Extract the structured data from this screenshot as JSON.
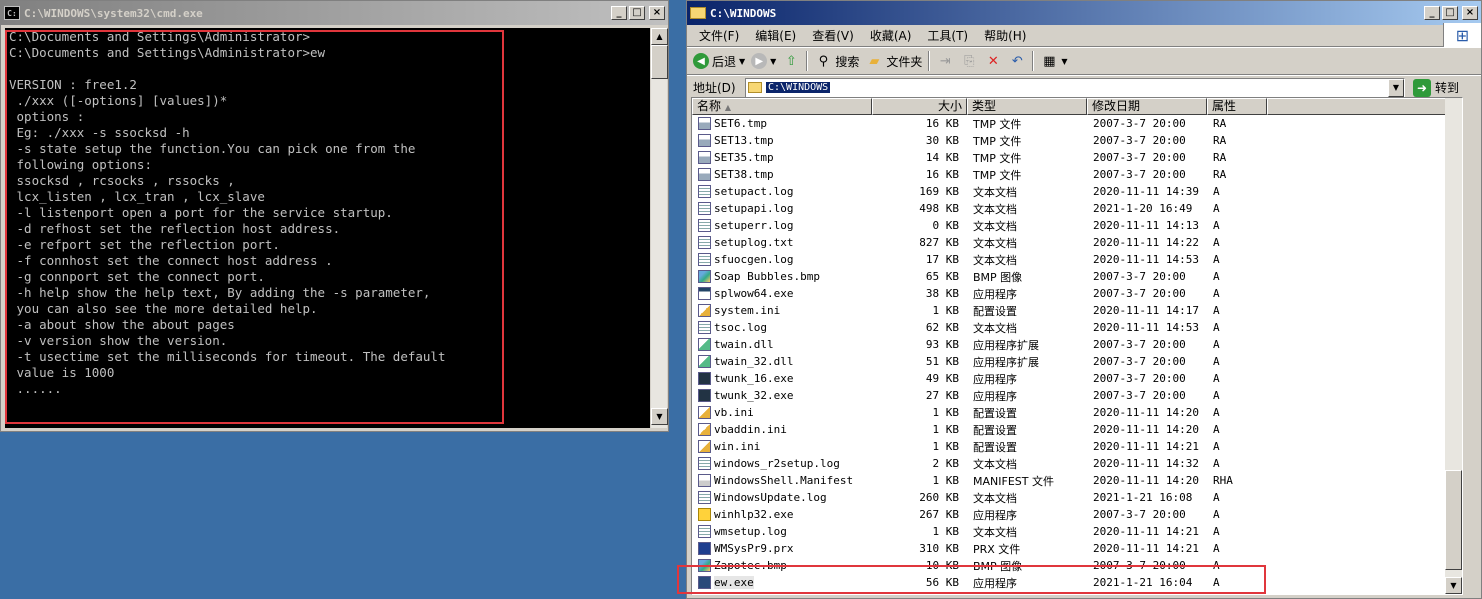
{
  "cmd": {
    "title": "C:\\WINDOWS\\system32\\cmd.exe",
    "lines": [
      "C:\\Documents and Settings\\Administrator>",
      "C:\\Documents and Settings\\Administrator>ew",
      "",
      "VERSION : free1.2",
      " ./xxx ([-options] [values])*",
      " options :",
      " Eg: ./xxx -s ssocksd -h",
      " -s state setup the function.You can pick one from the",
      " following options:",
      " ssocksd , rcsocks , rssocks ,",
      " lcx_listen , lcx_tran , lcx_slave",
      " -l listenport open a port for the service startup.",
      " -d refhost set the reflection host address.",
      " -e refport set the reflection port.",
      " -f connhost set the connect host address .",
      " -g connport set the connect port.",
      " -h help show the help text, By adding the -s parameter,",
      " you can also see the more detailed help.",
      " -a about show the about pages",
      " -v version show the version.",
      " -t usectime set the milliseconds for timeout. The default",
      " value is 1000",
      " ......"
    ]
  },
  "explorer": {
    "title": "C:\\WINDOWS",
    "menu": [
      "文件(F)",
      "编辑(E)",
      "查看(V)",
      "收藏(A)",
      "工具(T)",
      "帮助(H)"
    ],
    "toolbar": {
      "back": "后退",
      "search": "搜索",
      "folders": "文件夹"
    },
    "address_label": "地址(D)",
    "address_value": "C:\\WINDOWS",
    "go_label": "转到",
    "columns": [
      "名称",
      "大小",
      "类型",
      "修改日期",
      "属性"
    ],
    "files": [
      {
        "name": "SET6.tmp",
        "size": "16 KB",
        "type": "TMP 文件",
        "date": "2007-3-7 20:00",
        "attr": "RA",
        "icon": "tmp"
      },
      {
        "name": "SET13.tmp",
        "size": "30 KB",
        "type": "TMP 文件",
        "date": "2007-3-7 20:00",
        "attr": "RA",
        "icon": "tmp"
      },
      {
        "name": "SET35.tmp",
        "size": "14 KB",
        "type": "TMP 文件",
        "date": "2007-3-7 20:00",
        "attr": "RA",
        "icon": "tmp"
      },
      {
        "name": "SET38.tmp",
        "size": "16 KB",
        "type": "TMP 文件",
        "date": "2007-3-7 20:00",
        "attr": "RA",
        "icon": "tmp"
      },
      {
        "name": "setupact.log",
        "size": "169 KB",
        "type": "文本文档",
        "date": "2020-11-11 14:39",
        "attr": "A",
        "icon": "txt"
      },
      {
        "name": "setupapi.log",
        "size": "498 KB",
        "type": "文本文档",
        "date": "2021-1-20 16:49",
        "attr": "A",
        "icon": "txt"
      },
      {
        "name": "setuperr.log",
        "size": "0 KB",
        "type": "文本文档",
        "date": "2020-11-11 14:13",
        "attr": "A",
        "icon": "txt"
      },
      {
        "name": "setuplog.txt",
        "size": "827 KB",
        "type": "文本文档",
        "date": "2020-11-11 14:22",
        "attr": "A",
        "icon": "txt"
      },
      {
        "name": "sfuocgen.log",
        "size": "17 KB",
        "type": "文本文档",
        "date": "2020-11-11 14:53",
        "attr": "A",
        "icon": "txt"
      },
      {
        "name": "Soap Bubbles.bmp",
        "size": "65 KB",
        "type": "BMP 图像",
        "date": "2007-3-7 20:00",
        "attr": "A",
        "icon": "bmp"
      },
      {
        "name": "splwow64.exe",
        "size": "38 KB",
        "type": "应用程序",
        "date": "2007-3-7 20:00",
        "attr": "A",
        "icon": "exe"
      },
      {
        "name": "system.ini",
        "size": "1 KB",
        "type": "配置设置",
        "date": "2020-11-11 14:17",
        "attr": "A",
        "icon": "ini"
      },
      {
        "name": "tsoc.log",
        "size": "62 KB",
        "type": "文本文档",
        "date": "2020-11-11 14:53",
        "attr": "A",
        "icon": "txt"
      },
      {
        "name": "twain.dll",
        "size": "93 KB",
        "type": "应用程序扩展",
        "date": "2007-3-7 20:00",
        "attr": "A",
        "icon": "dll"
      },
      {
        "name": "twain_32.dll",
        "size": "51 KB",
        "type": "应用程序扩展",
        "date": "2007-3-7 20:00",
        "attr": "A",
        "icon": "dll"
      },
      {
        "name": "twunk_16.exe",
        "size": "49 KB",
        "type": "应用程序",
        "date": "2007-3-7 20:00",
        "attr": "A",
        "icon": "twunk"
      },
      {
        "name": "twunk_32.exe",
        "size": "27 KB",
        "type": "应用程序",
        "date": "2007-3-7 20:00",
        "attr": "A",
        "icon": "twunk"
      },
      {
        "name": "vb.ini",
        "size": "1 KB",
        "type": "配置设置",
        "date": "2020-11-11 14:20",
        "attr": "A",
        "icon": "ini"
      },
      {
        "name": "vbaddin.ini",
        "size": "1 KB",
        "type": "配置设置",
        "date": "2020-11-11 14:20",
        "attr": "A",
        "icon": "ini"
      },
      {
        "name": "win.ini",
        "size": "1 KB",
        "type": "配置设置",
        "date": "2020-11-11 14:21",
        "attr": "A",
        "icon": "ini"
      },
      {
        "name": "windows_r2setup.log",
        "size": "2 KB",
        "type": "文本文档",
        "date": "2020-11-11 14:32",
        "attr": "A",
        "icon": "txt"
      },
      {
        "name": "WindowsShell.Manifest",
        "size": "1 KB",
        "type": "MANIFEST 文件",
        "date": "2020-11-11 14:20",
        "attr": "RHA",
        "icon": "man"
      },
      {
        "name": "WindowsUpdate.log",
        "size": "260 KB",
        "type": "文本文档",
        "date": "2021-1-21 16:08",
        "attr": "A",
        "icon": "txt"
      },
      {
        "name": "winhlp32.exe",
        "size": "267 KB",
        "type": "应用程序",
        "date": "2007-3-7 20:00",
        "attr": "A",
        "icon": "help"
      },
      {
        "name": "wmsetup.log",
        "size": "1 KB",
        "type": "文本文档",
        "date": "2020-11-11 14:21",
        "attr": "A",
        "icon": "txt"
      },
      {
        "name": "WMSysPr9.prx",
        "size": "310 KB",
        "type": "PRX 文件",
        "date": "2020-11-11 14:21",
        "attr": "A",
        "icon": "prx"
      },
      {
        "name": "Zapotec.bmp",
        "size": "10 KB",
        "type": "BMP 图像",
        "date": "2007-3-7 20:00",
        "attr": "A",
        "icon": "bmp"
      },
      {
        "name": "ew.exe",
        "size": "56 KB",
        "type": "应用程序",
        "date": "2021-1-21 16:04",
        "attr": "A",
        "icon": "ew"
      }
    ]
  },
  "colors": {
    "highlight_box": "#e0363c",
    "active_title": "#0a246a",
    "desktop": "#3a6ea5"
  }
}
